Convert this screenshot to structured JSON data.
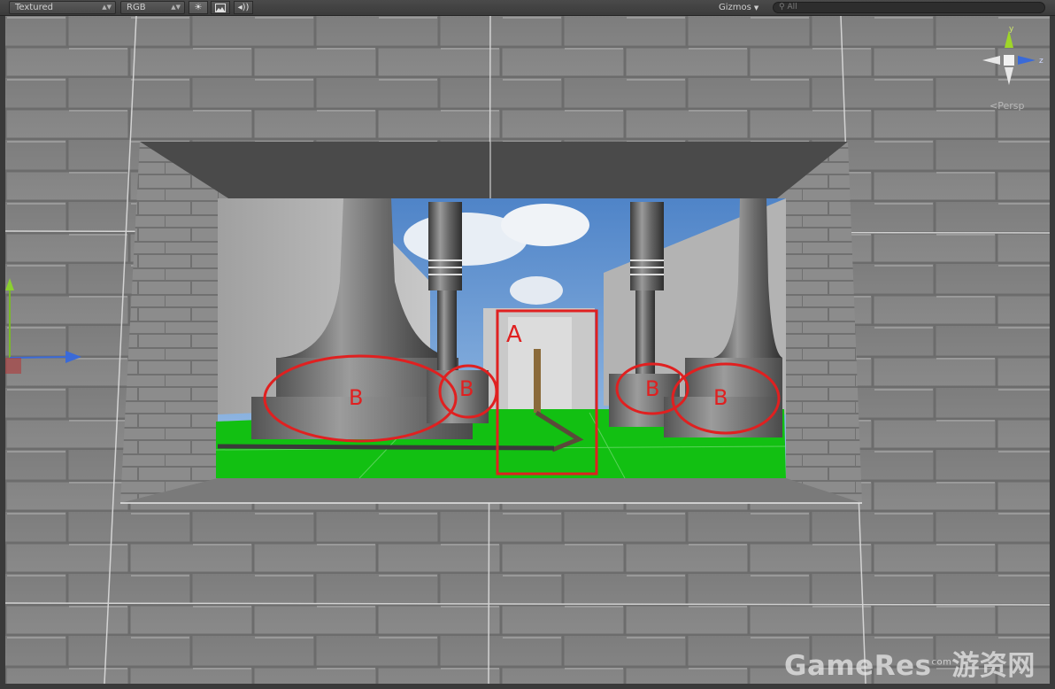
{
  "toolbar": {
    "render_mode": "Textured",
    "color_mode": "RGB",
    "lighting_icon": "sun-icon",
    "image_icon": "image-icon",
    "audio_icon": "audio-icon",
    "gizmos_label": "Gizmos",
    "search_placeholder": "All"
  },
  "scene": {
    "annotation_a": "A",
    "annotation_b": "B",
    "annotation_color": "#e02020",
    "ground_color": "#12c012",
    "wall_color": "#8a8a8a"
  },
  "gizmo": {
    "axis_y": "y",
    "axis_z": "z",
    "projection": "Persp"
  },
  "watermark": {
    "main": "GameRes",
    "com": "com",
    "cn": "游资网"
  }
}
